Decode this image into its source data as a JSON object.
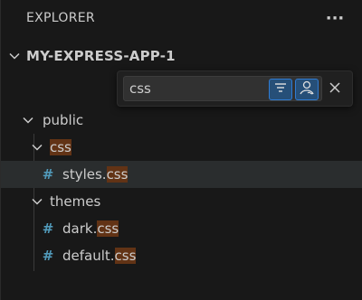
{
  "explorer": {
    "title": "EXPLORER",
    "more_actions": "···"
  },
  "project": {
    "name": "MY-EXPRESS-APP-1"
  },
  "find_widget": {
    "query": "css",
    "filter_toggle": "filter-icon",
    "fuzzy_toggle": "fuzzy-match-icon",
    "close": "close-icon"
  },
  "tree": {
    "public": {
      "label": "public"
    },
    "css_folder": {
      "label": "css"
    },
    "styles": {
      "name": "styles.",
      "ext": "css"
    },
    "themes": {
      "label": "themes"
    },
    "dark": {
      "name": "dark.",
      "ext": "css"
    },
    "default": {
      "name": "default.",
      "ext": "css"
    },
    "file_icon": "#"
  },
  "colors": {
    "background": "#181818",
    "highlight": "#623315",
    "css_icon": "#519aba",
    "toggle_active": "#264f78",
    "selected_row": "#2a2d2e"
  }
}
